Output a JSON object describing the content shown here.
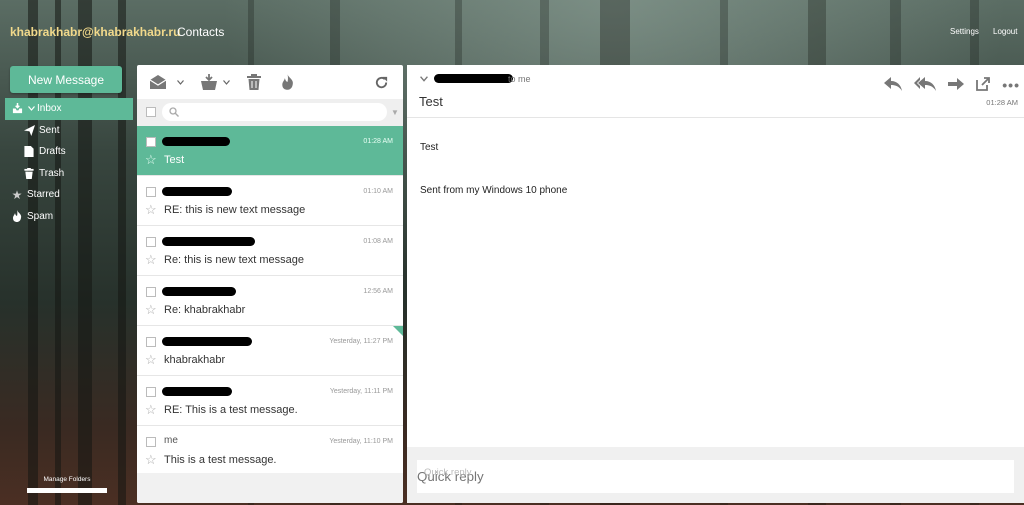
{
  "header": {
    "account": "khabrakhabr@khabrakhabr.ru",
    "contacts": "Contacts",
    "settings": "Settings",
    "logout": "Logout"
  },
  "sidebar": {
    "new_message": "New Message",
    "folders": [
      {
        "label": "Inbox",
        "icon": "inbox-icon",
        "active": true
      },
      {
        "label": "Sent",
        "icon": "send-icon"
      },
      {
        "label": "Drafts",
        "icon": "draft-icon"
      },
      {
        "label": "Trash",
        "icon": "trash-icon"
      },
      {
        "label": "Starred",
        "icon": "star-icon"
      },
      {
        "label": "Spam",
        "icon": "fire-icon"
      }
    ],
    "manage_folders": "Manage Folders"
  },
  "list": {
    "toolbar_icons": [
      "read-envelope-icon",
      "chevron-down-icon",
      "move-to-folder-icon",
      "chevron-down-icon",
      "trash-icon",
      "fire-icon",
      "refresh-icon"
    ],
    "messages": [
      {
        "sender": "",
        "time": "01:28 AM",
        "subject": "Test",
        "selected": true
      },
      {
        "sender": "",
        "time": "01:10 AM",
        "subject": "RE: this is new text message"
      },
      {
        "sender": "",
        "time": "01:08 AM",
        "subject": "Re: this is new text message"
      },
      {
        "sender": "",
        "time": "12:56 AM",
        "subject": "Re: khabrakhabr"
      },
      {
        "sender": "",
        "time": "Yesterday, 11:27 PM",
        "subject": "khabrakhabr"
      },
      {
        "sender": "",
        "time": "Yesterday, 11:11 PM",
        "subject": "RE: This is a test message."
      },
      {
        "sender": "me",
        "time": "Yesterday, 11:10 PM",
        "subject": "This is a test message."
      }
    ]
  },
  "reader": {
    "to": "to me",
    "subject": "Test",
    "time": "01:28 AM",
    "body_line1": "Test",
    "body_line2": "Sent from my Windows 10 phone",
    "quick_reply_placeholder": "Quick reply",
    "action_icons": [
      "reply-icon",
      "reply-all-icon",
      "forward-icon",
      "pop-out-icon",
      "more-icon"
    ]
  },
  "colors": {
    "accent": "#5eb998",
    "account_text": "#f1d98b"
  }
}
